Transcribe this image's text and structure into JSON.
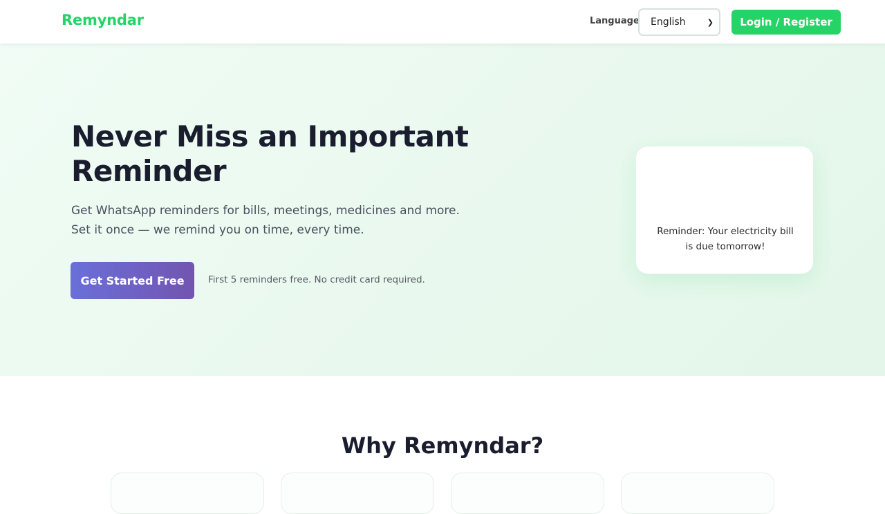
{
  "brand": {
    "name": "Remyndar",
    "color": "#25d366"
  },
  "nav": {
    "language_label": "Language",
    "language_selected": "English",
    "login_label": "Login / Register"
  },
  "hero": {
    "title": "Never Miss an Important Reminder",
    "subtitle_line1": "Get WhatsApp reminders for bills, meetings, medicines and more.",
    "subtitle_line2": "Set it once — we remind you on time, every time.",
    "cta_label": "Get Started Free",
    "cta_note": "First 5 reminders free. No credit card required.",
    "sample_message": "Reminder: Your electricity bill is due tomorrow!"
  },
  "features": {
    "title": "Why Remyndar?",
    "cards": [
      "",
      "",
      "",
      ""
    ]
  },
  "colors": {
    "accent": "#25d366",
    "cta_gradient_start": "#6a6fd9",
    "cta_gradient_end": "#7255b0",
    "text_dark": "#1a1d2e"
  }
}
